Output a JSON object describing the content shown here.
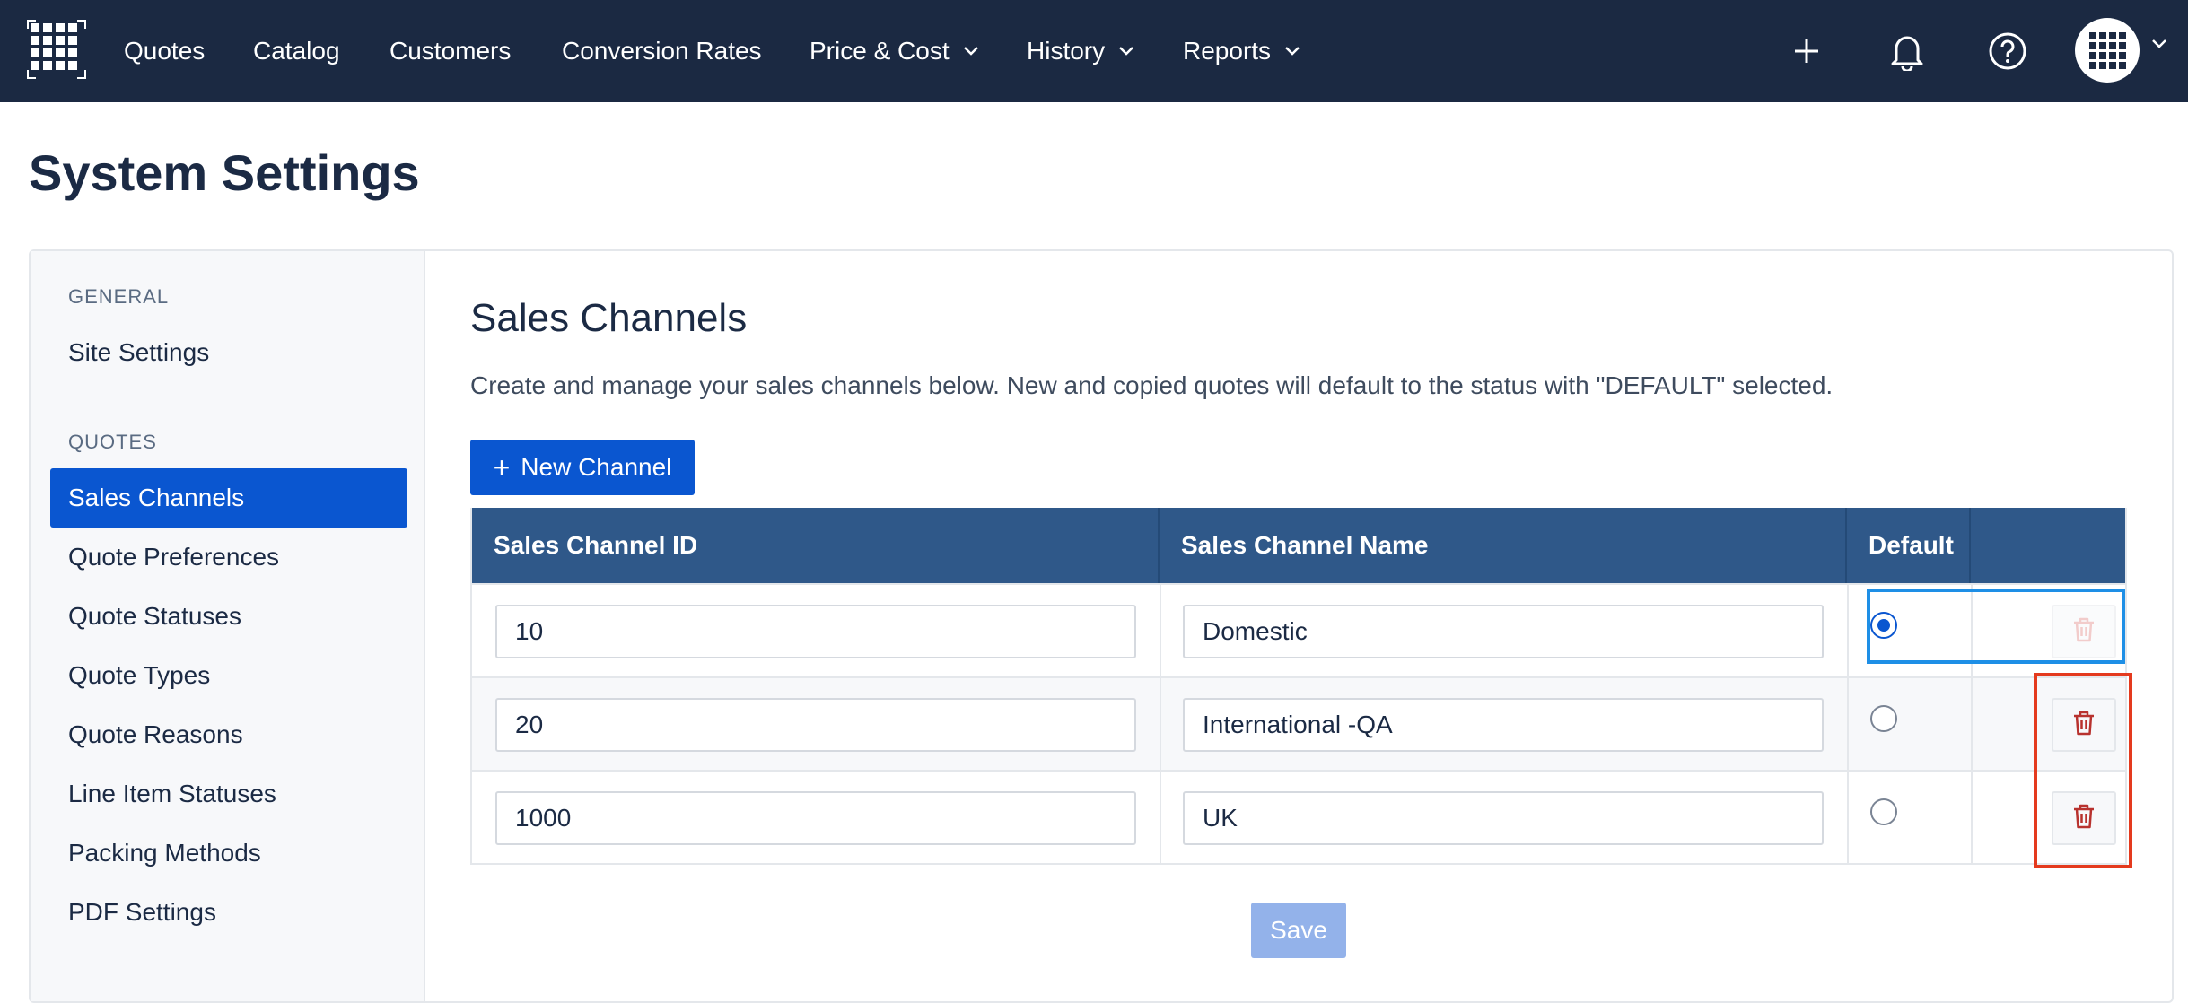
{
  "nav": {
    "items": [
      {
        "label": "Quotes"
      },
      {
        "label": "Catalog"
      },
      {
        "label": "Customers"
      },
      {
        "label": "Conversion Rates"
      },
      {
        "label": "Price & Cost"
      },
      {
        "label": "History"
      },
      {
        "label": "Reports"
      }
    ],
    "icons": [
      "plus-icon",
      "bell-icon",
      "help-icon",
      "avatar",
      "chevron-down-icon"
    ]
  },
  "page": {
    "title": "System Settings"
  },
  "sidebar": {
    "sections": [
      {
        "heading": "GENERAL",
        "items": [
          {
            "label": "Site Settings"
          }
        ]
      },
      {
        "heading": "QUOTES",
        "items": [
          {
            "label": "Sales Channels",
            "active": true
          },
          {
            "label": "Quote Preferences"
          },
          {
            "label": "Quote Statuses"
          },
          {
            "label": "Quote Types"
          },
          {
            "label": "Quote Reasons"
          },
          {
            "label": "Line Item Statuses"
          },
          {
            "label": "Packing Methods"
          },
          {
            "label": "PDF Settings"
          }
        ]
      }
    ]
  },
  "content": {
    "title": "Sales Channels",
    "description": "Create and manage your sales channels below. New and copied quotes will default to the status with \"DEFAULT\" selected.",
    "new_button": "New Channel",
    "save_button": "Save",
    "table": {
      "headers": [
        "Sales Channel ID",
        "Sales Channel Name",
        "Default",
        ""
      ],
      "rows": [
        {
          "id": "10",
          "name": "Domestic",
          "default": true,
          "delete_enabled": false
        },
        {
          "id": "20",
          "name": "International -QA",
          "default": false,
          "delete_enabled": true
        },
        {
          "id": "1000",
          "name": "UK",
          "default": false,
          "delete_enabled": true
        }
      ]
    }
  },
  "colors": {
    "topbar": "#1b2942",
    "primary": "#0a56d0",
    "table_header": "#2f5889",
    "highlight_blue": "#1e8fe6",
    "highlight_red": "#e43a1e",
    "trash_red": "#b8322e"
  }
}
